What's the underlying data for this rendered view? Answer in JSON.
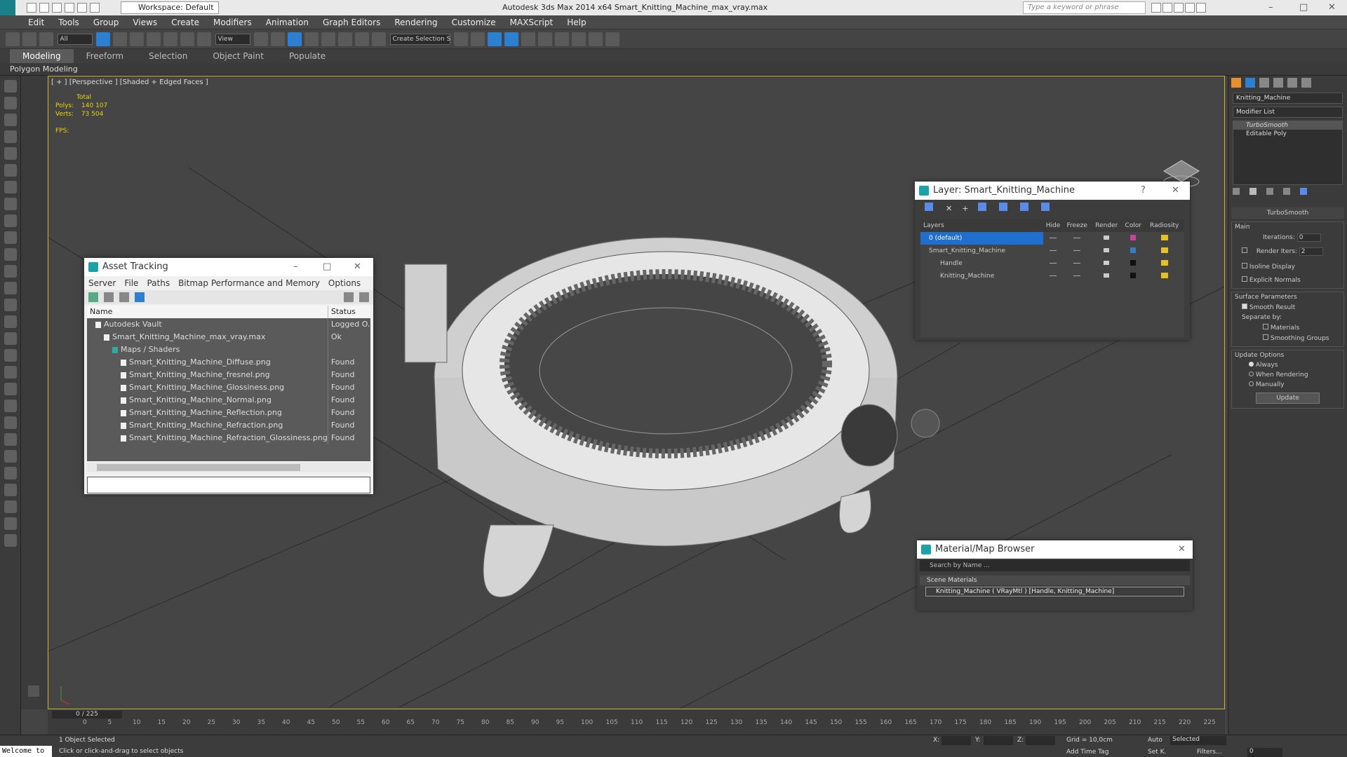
{
  "titlebar": {
    "workspace": "Workspace: Default",
    "title": "Autodesk 3ds Max  2014 x64     Smart_Knitting_Machine_max_vray.max",
    "search_placeholder": "Type a keyword or phrase"
  },
  "menu": [
    "Edit",
    "Tools",
    "Group",
    "Views",
    "Create",
    "Modifiers",
    "Animation",
    "Graph Editors",
    "Rendering",
    "Customize",
    "MAXScript",
    "Help"
  ],
  "toolbar": {
    "filter": "All",
    "refcoord": "View",
    "selset": "Create Selection S"
  },
  "ribbon": {
    "tabs": [
      "Modeling",
      "Freeform",
      "Selection",
      "Object Paint",
      "Populate"
    ],
    "sub": "Polygon Modeling"
  },
  "viewport": {
    "label": "[ + ] [Perspective ] [Shaded + Edged Faces ]",
    "stats": {
      "total": "Total",
      "polys_label": "Polys:",
      "polys": "140 107",
      "verts_label": "Verts:",
      "verts": "73 504",
      "fps": "FPS:"
    }
  },
  "asset_tracking": {
    "title": "Asset Tracking",
    "menu": [
      "Server",
      "File",
      "Paths",
      "Bitmap Performance and Memory",
      "Options"
    ],
    "headers": [
      "Name",
      "Status"
    ],
    "rows": [
      {
        "name": "Autodesk Vault",
        "status": "Logged O...",
        "indent": 1
      },
      {
        "name": "Smart_Knitting_Machine_max_vray.max",
        "status": "Ok",
        "indent": 2
      },
      {
        "name": "Maps / Shaders",
        "status": "",
        "indent": 3
      },
      {
        "name": "Smart_Knitting_Machine_Diffuse.png",
        "status": "Found",
        "indent": 4
      },
      {
        "name": "Smart_Knitting_Machine_fresnel.png",
        "status": "Found",
        "indent": 4
      },
      {
        "name": "Smart_Knitting_Machine_Glossiness.png",
        "status": "Found",
        "indent": 4
      },
      {
        "name": "Smart_Knitting_Machine_Normal.png",
        "status": "Found",
        "indent": 4
      },
      {
        "name": "Smart_Knitting_Machine_Reflection.png",
        "status": "Found",
        "indent": 4
      },
      {
        "name": "Smart_Knitting_Machine_Refraction.png",
        "status": "Found",
        "indent": 4
      },
      {
        "name": "Smart_Knitting_Machine_Refraction_Glossiness.png",
        "status": "Found",
        "indent": 4
      }
    ]
  },
  "layer": {
    "title": "Layer: Smart_Knitting_Machine",
    "headers": [
      "Layers",
      "Hide",
      "Freeze",
      "Render",
      "Color",
      "Radiosity"
    ],
    "rows": [
      {
        "name": "0 (default)",
        "sel": true,
        "color": "#d040a0"
      },
      {
        "name": "Smart_Knitting_Machine",
        "sel": false,
        "color": "#2a7fd0"
      },
      {
        "name": "Handle",
        "sel": false,
        "color": "#111111"
      },
      {
        "name": "Knitting_Machine",
        "sel": false,
        "color": "#111111"
      }
    ]
  },
  "material": {
    "title": "Material/Map Browser",
    "search": "Search by Name ...",
    "section": "Scene Materials",
    "item": "Knitting_Machine  ( VRayMtl ) [Handle, Knitting_Machine]"
  },
  "cmd": {
    "object": "Knitting_Machine",
    "modlist": "Modifier List",
    "stack": [
      "TurboSmooth",
      "Editable Poly"
    ],
    "rollout": "TurboSmooth",
    "main": "Main",
    "iterations_label": "Iterations:",
    "iterations": "0",
    "render_iters_label": "Render Iters:",
    "render_iters": "2",
    "isoline": "Isoline Display",
    "explicit": "Explicit Normals",
    "surface": "Surface Parameters",
    "smooth": "Smooth Result",
    "separate": "Separate by:",
    "materials": "Materials",
    "smoothing": "Smoothing Groups",
    "update_opts": "Update Options",
    "always": "Always",
    "when": "When Rendering",
    "manually": "Manually",
    "update": "Update"
  },
  "timeline": {
    "frame": "0 / 225",
    "ticks": [
      "0",
      "5",
      "10",
      "15",
      "20",
      "25",
      "30",
      "35",
      "40",
      "45",
      "50",
      "55",
      "60",
      "65",
      "70",
      "75",
      "80",
      "85",
      "90",
      "95",
      "100",
      "105",
      "110",
      "115",
      "120",
      "125",
      "130",
      "135",
      "140",
      "145",
      "150",
      "155",
      "160",
      "165",
      "170",
      "175",
      "180",
      "185",
      "190",
      "195",
      "200",
      "205",
      "210",
      "215",
      "220",
      "225"
    ]
  },
  "status": {
    "welcome": "Welcome to",
    "selected": "1 Object Selected",
    "hint": "Click or click-and-drag to select objects",
    "x": "X:",
    "y": "Y:",
    "z": "Z:",
    "grid": "Grid = 10,0cm",
    "addtag": "Add Time Tag",
    "auto": "Auto",
    "setk": "Set K.",
    "sel": "Selected",
    "filters": "Filters...",
    "frame": "0"
  },
  "colors": {
    "viewport_border": "#c8b342",
    "selection": "#1e6fd0",
    "accent": "#2d7fd1"
  }
}
